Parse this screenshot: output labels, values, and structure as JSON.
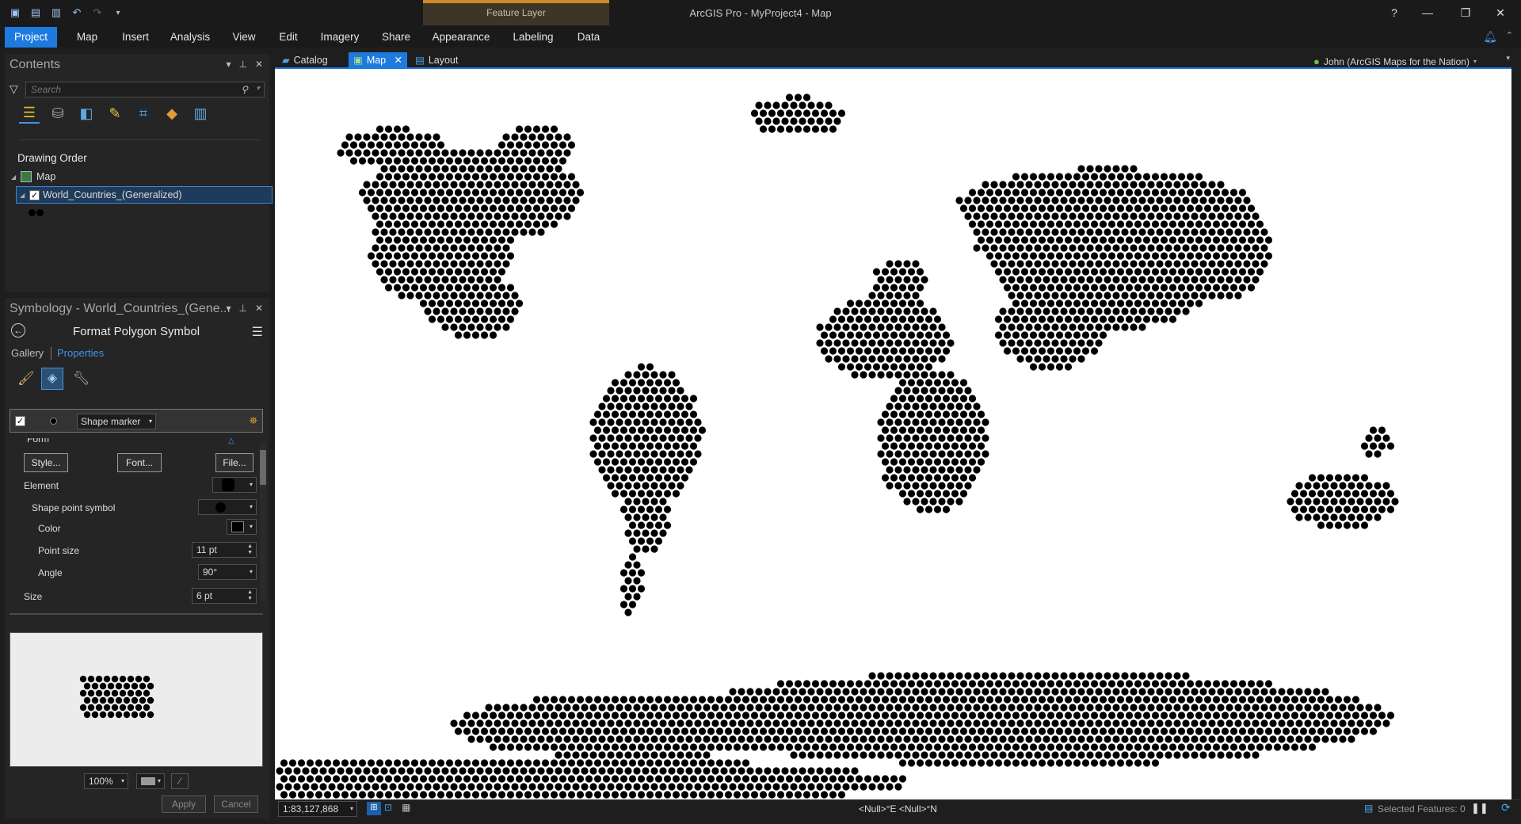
{
  "app": {
    "title": "ArcGIS Pro - MyProject4 - Map",
    "contextual_tab_group": "Feature Layer",
    "user": "John (ArcGIS Maps for the Nation)"
  },
  "ribbon": {
    "tabs": [
      "Project",
      "Map",
      "Insert",
      "Analysis",
      "View",
      "Edit",
      "Imagery",
      "Share",
      "Appearance",
      "Labeling",
      "Data"
    ]
  },
  "window_controls": [
    "?",
    "—",
    "❐",
    "✕"
  ],
  "contents": {
    "title": "Contents",
    "search_placeholder": "Search",
    "section": "Drawing Order",
    "map_label": "Map",
    "layer_label": "World_Countries_(Generalized)"
  },
  "symbology": {
    "title": "Symbology - World_Countries_(Gene...",
    "subtitle": "Format Polygon Symbol",
    "tab_gallery": "Gallery",
    "tab_properties": "Properties",
    "layer_type": "Shape marker",
    "form_label": "Form",
    "style_button": "Style...",
    "font_button": "Font...",
    "file_button": "File...",
    "element_label": "Element",
    "shape_point_symbol_label": "Shape point symbol",
    "color_label": "Color",
    "point_size_label": "Point size",
    "point_size_value": "11 pt",
    "angle_label": "Angle",
    "angle_value": "90°",
    "size_label": "Size",
    "size_value": "6 pt",
    "zoom_value": "100%",
    "apply_button": "Apply",
    "cancel_button": "Cancel"
  },
  "views": {
    "tabs": [
      "Catalog",
      "Map",
      "Layout"
    ]
  },
  "status": {
    "scale": "1:83,127,868",
    "coordinates": "<Null>°E <Null>°N",
    "selected_features": "Selected Features: 0"
  },
  "colors": {
    "accent": "#1d7be0",
    "contextual": "#d28a27",
    "marker": "#000000",
    "map_background": "#ffffff"
  }
}
